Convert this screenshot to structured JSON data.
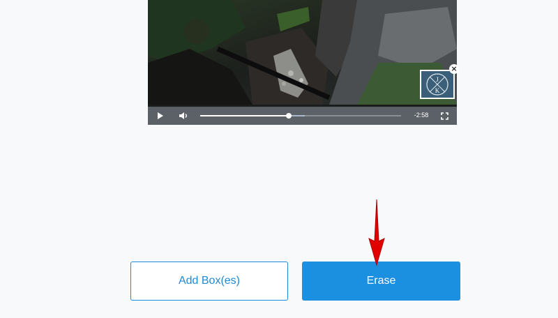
{
  "player": {
    "time_remaining": "-2:58",
    "progress_fraction": 0.44,
    "buffered_fraction": 0.52,
    "play_icon": "play-icon",
    "volume_icon": "volume-icon",
    "fullscreen_icon": "fullscreen-icon"
  },
  "watermark": {
    "letters": [
      "J",
      "K"
    ],
    "close_label": "×"
  },
  "actions": {
    "add_label": "Add Box(es)",
    "erase_label": "Erase"
  },
  "colors": {
    "primary": "#1b8fe0",
    "arrow": "#e00000",
    "page_bg": "#f7f9fb"
  }
}
